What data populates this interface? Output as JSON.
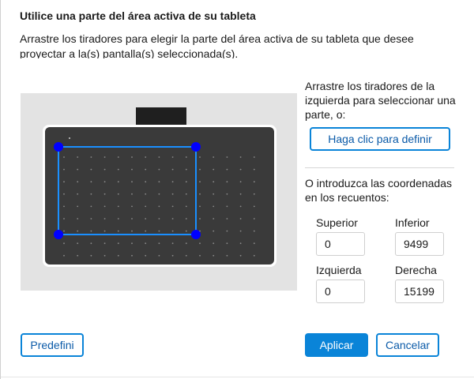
{
  "dialog": {
    "title": "Utilice una parte del área activa de su tableta",
    "description": "Arrastre los tiradores para elegir la parte del área activa de su tableta que desee proyectar a la(s) pantalla(s) seleccionada(s)."
  },
  "panel": {
    "drag_hint": "Arrastre los tiradores de la izquierda para seleccionar una parte, o:",
    "define_button": "Haga clic para definir",
    "coords_hint": "O introduzca las coordenadas en los recuentos:"
  },
  "coordinates": {
    "top_label": "Superior",
    "top_value": "0",
    "bottom_label": "Inferior",
    "bottom_value": "9499",
    "left_label": "Izquierda",
    "left_value": "0",
    "right_label": "Derecha",
    "right_value": "15199"
  },
  "footer": {
    "default_button": "Predefini",
    "apply_button": "Aplicar",
    "cancel_button": "Cancelar"
  },
  "colors": {
    "accent": "#0a84d8",
    "handle": "#0000ff",
    "selection": "#1a8fff",
    "tablet_surface": "#3a3a3a"
  },
  "icons": {
    "handle": "selection-handle-dot"
  }
}
